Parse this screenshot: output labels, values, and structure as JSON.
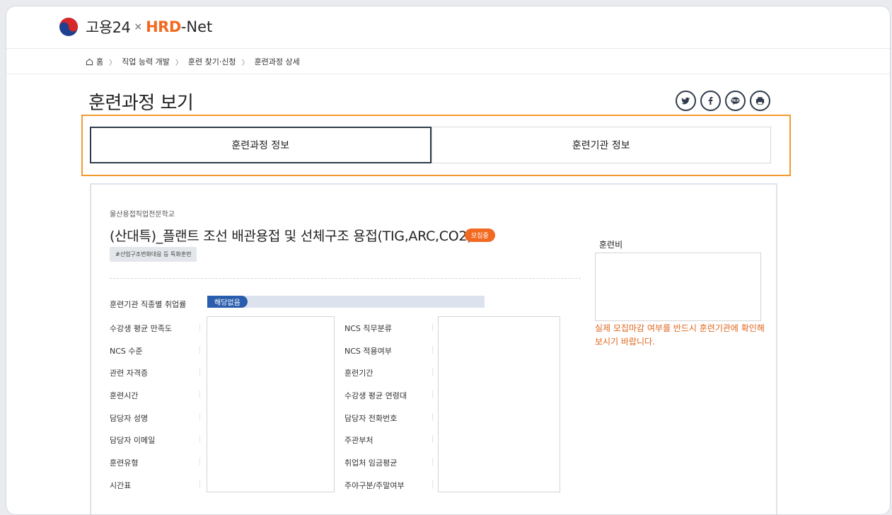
{
  "header": {
    "brand": "고용24",
    "brand_sep": "×",
    "hrd": "HRD",
    "net": "-Net"
  },
  "breadcrumb": {
    "items": [
      "홈",
      "직업 능력 개발",
      "훈련 찾기·신청",
      "훈련과정 상세"
    ]
  },
  "page": {
    "title": "훈련과정 보기"
  },
  "share": {
    "icons": [
      "twitter-icon",
      "facebook-icon",
      "talk-icon",
      "print-icon"
    ]
  },
  "tabs": [
    {
      "label": "훈련과정 정보",
      "active": true
    },
    {
      "label": "훈련기관 정보",
      "active": false
    }
  ],
  "course": {
    "institution": "울산용접직업전문학교",
    "title": "(산대특)_플랜트 조선 배관용접 및 선체구조 용접(TIG,ARC,CO2)",
    "status_badge": "모집중",
    "hashtag": "#산업구조변화대응 등 특화훈련",
    "employment_label": "훈련기관 직종별 취업률",
    "employment_value": "해당없음",
    "left_fields": [
      "수강생 평균 만족도",
      "NCS 수준",
      "관련 자격증",
      "훈련시간",
      "담당자 성명",
      "담당자 이메일",
      "훈련유형",
      "시간표"
    ],
    "right_fields": [
      "NCS 직무분류",
      "NCS 적용여부",
      "훈련기간",
      "수강생 평균 연령대",
      "담당자 전화번호",
      "주관부처",
      "취업처 임금평균",
      "주야구분/주말여부"
    ]
  },
  "fee": {
    "label": "훈련비",
    "notice": "실제 모집마감 여부를 반드시 훈련기관에 확인해보시기 바랍니다."
  },
  "colors": {
    "accent_orange": "#f26a21",
    "highlight_border": "#f39a2e",
    "navy": "#2f3b4c",
    "blue_pill": "#2a5dad"
  }
}
